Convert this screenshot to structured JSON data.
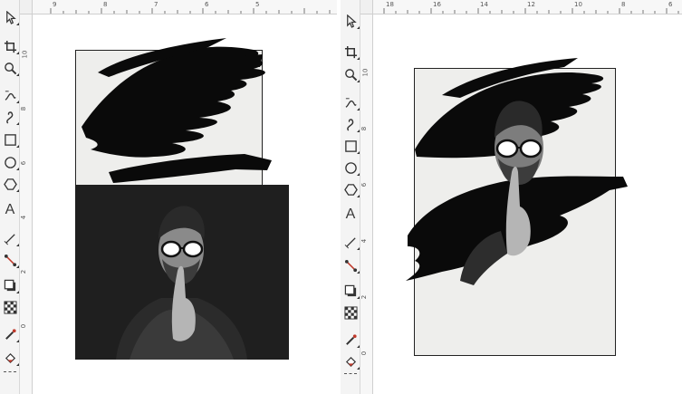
{
  "left_view": {
    "hruler_labels": [
      "9",
      "8",
      "7",
      "6",
      "5"
    ],
    "vruler_labels": [
      "10",
      "8",
      "6",
      "4",
      "2",
      "0"
    ]
  },
  "right_view": {
    "hruler_labels": [
      "18",
      "16",
      "14",
      "12",
      "10",
      "8",
      "6"
    ],
    "vruler_labels": [
      "10",
      "8",
      "6",
      "4",
      "2",
      "0"
    ]
  },
  "toolbar": {
    "tools": [
      "pick-tool",
      "crop-tool",
      "zoom-tool",
      "freehand-tool",
      "bezier-tool",
      "rectangle-tool",
      "ellipse-tool",
      "polygon-tool",
      "text-tool",
      "dimension-tool",
      "connector-tool",
      "drop-shadow-tool",
      "transparency-tool",
      "eyedropper-tool",
      "fill-tool"
    ]
  },
  "colors": {
    "canvas": "#ffffff",
    "page": "#eeeeec",
    "brush": "#0a0a0a",
    "photo_bg": "#1f1f1f",
    "toolbar": "#f4f4f4"
  }
}
